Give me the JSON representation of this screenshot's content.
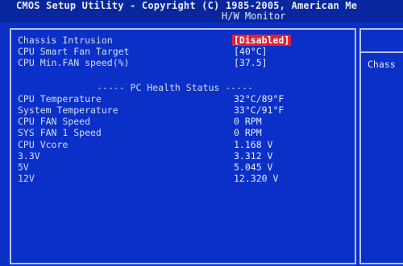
{
  "header": {
    "title": "CMOS Setup Utility - Copyright (C) 1985-2005, American Me",
    "subtitle": "H/W Monitor"
  },
  "settings": [
    {
      "label": "Chassis Intrusion",
      "value": "[Disabled]"
    },
    {
      "label": "CPU Smart Fan Target",
      "value": "[40°C]"
    },
    {
      "label": "CPU Min.FAN speed(%)",
      "value": "[37.5]"
    }
  ],
  "section_title": "----- PC Health Status -----",
  "readings": [
    {
      "label": "CPU Temperature",
      "value": "32°C/89°F"
    },
    {
      "label": "System Temperature",
      "value": "33°C/91°F"
    },
    {
      "label": "CPU FAN Speed",
      "value": "0 RPM"
    },
    {
      "label": "SYS FAN 1 Speed",
      "value": "0 RPM"
    },
    {
      "label": "CPU Vcore",
      "value": "1.168 V"
    },
    {
      "label": "3.3V",
      "value": "3.312 V"
    },
    {
      "label": "5V",
      "value": "5.045 V"
    },
    {
      "label": "12V",
      "value": "12.320 V"
    }
  ],
  "help": {
    "text": "Chass"
  },
  "colors": {
    "background": "#0a30c8",
    "selected_bg": "#e0203a",
    "text": "#d6ddf8"
  }
}
